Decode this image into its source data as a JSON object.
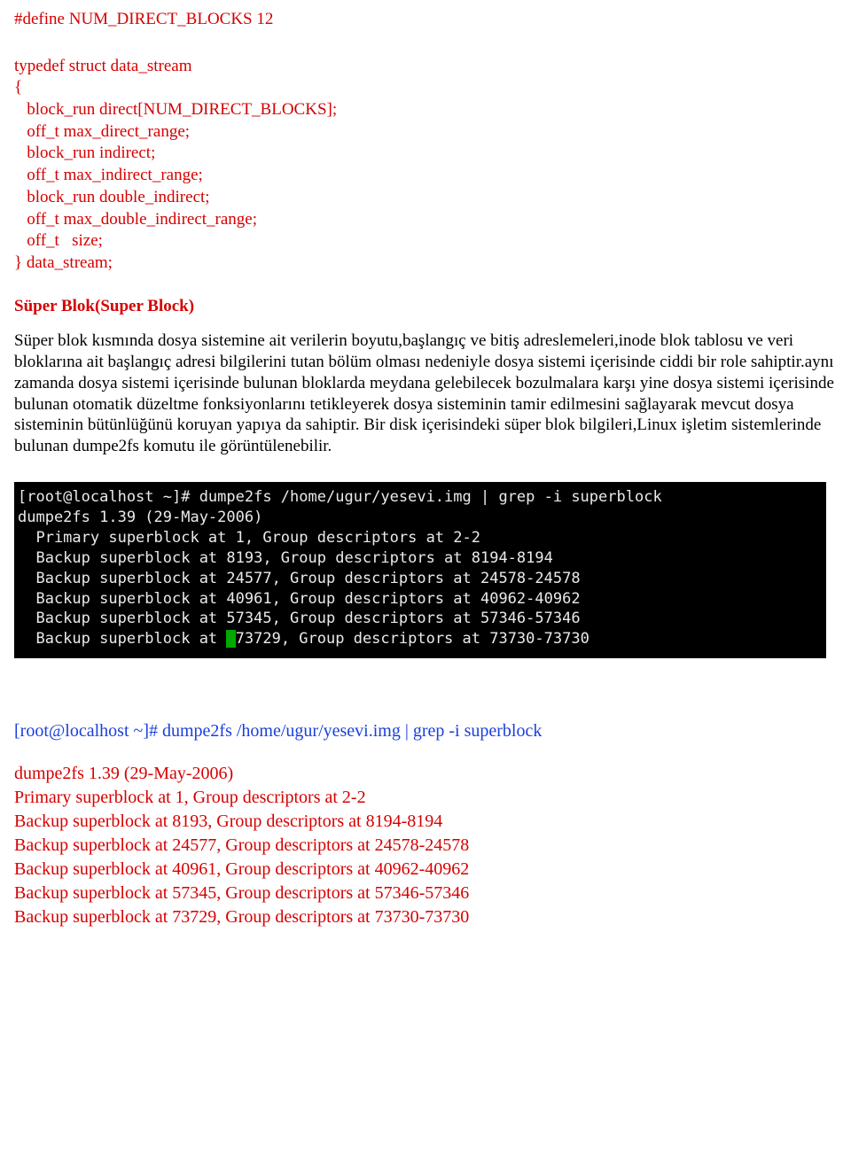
{
  "code": {
    "l1": "#define NUM_DIRECT_BLOCKS 12",
    "l2": "typedef struct data_stream",
    "l3": "{",
    "l4": "   block_run direct[NUM_DIRECT_BLOCKS];",
    "l5": "   off_t max_direct_range;",
    "l6": "   block_run indirect;",
    "l7": "   off_t max_indirect_range;",
    "l8": "   block_run double_indirect;",
    "l9": "   off_t max_double_indirect_range;",
    "l10": "   off_t   size;",
    "l11": "} data_stream;"
  },
  "heading": "Süper Blok(Super Block)",
  "paragraph": "Süper blok kısmında dosya sistemine ait verilerin boyutu,başlangıç ve bitiş adreslemeleri,inode blok tablosu ve veri bloklarına ait başlangıç adresi bilgilerini tutan bölüm olması nedeniyle dosya sistemi içerisinde ciddi bir role sahiptir.aynı zamanda dosya sistemi içerisinde bulunan bloklarda meydana gelebilecek bozulmalara karşı yine dosya sistemi içerisinde bulunan otomatik düzeltme fonksiyonlarını tetikleyerek dosya sisteminin tamir edilmesini sağlayarak mevcut dosya sisteminin bütünlüğünü koruyan yapıya da sahiptir. Bir disk içerisindeki süper blok bilgileri,Linux işletim sistemlerinde bulunan dumpe2fs komutu ile görüntülenebilir.",
  "terminal": {
    "l1": "[root@localhost ~]# dumpe2fs /home/ugur/yesevi.img | grep -i superblock",
    "l2": "dumpe2fs 1.39 (29-May-2006)",
    "l3": "  Primary superblock at 1, Group descriptors at 2-2",
    "l4": "  Backup superblock at 8193, Group descriptors at 8194-8194",
    "l5": "  Backup superblock at 24577, Group descriptors at 24578-24578",
    "l6": "  Backup superblock at 40961, Group descriptors at 40962-40962",
    "l7": "  Backup superblock at 57345, Group descriptors at 57346-57346",
    "l8a": "  Backup superblock at ",
    "l8b": "73729, Group descriptors at 73730-73730"
  },
  "cmd_line": "[root@localhost ~]# dumpe2fs /home/ugur/yesevi.img | grep -i superblock",
  "output": {
    "o1": "dumpe2fs 1.39 (29-May-2006)",
    "o2": "Primary superblock at 1, Group descriptors at 2-2",
    "o3": "Backup superblock at 8193, Group descriptors at 8194-8194",
    "o4": "Backup superblock at 24577, Group descriptors at 24578-24578",
    "o5": "Backup superblock at 40961, Group descriptors at 40962-40962",
    "o6": "Backup superblock at 57345, Group descriptors at 57346-57346",
    "o7": "Backup superblock at 73729, Group descriptors at 73730-73730"
  }
}
